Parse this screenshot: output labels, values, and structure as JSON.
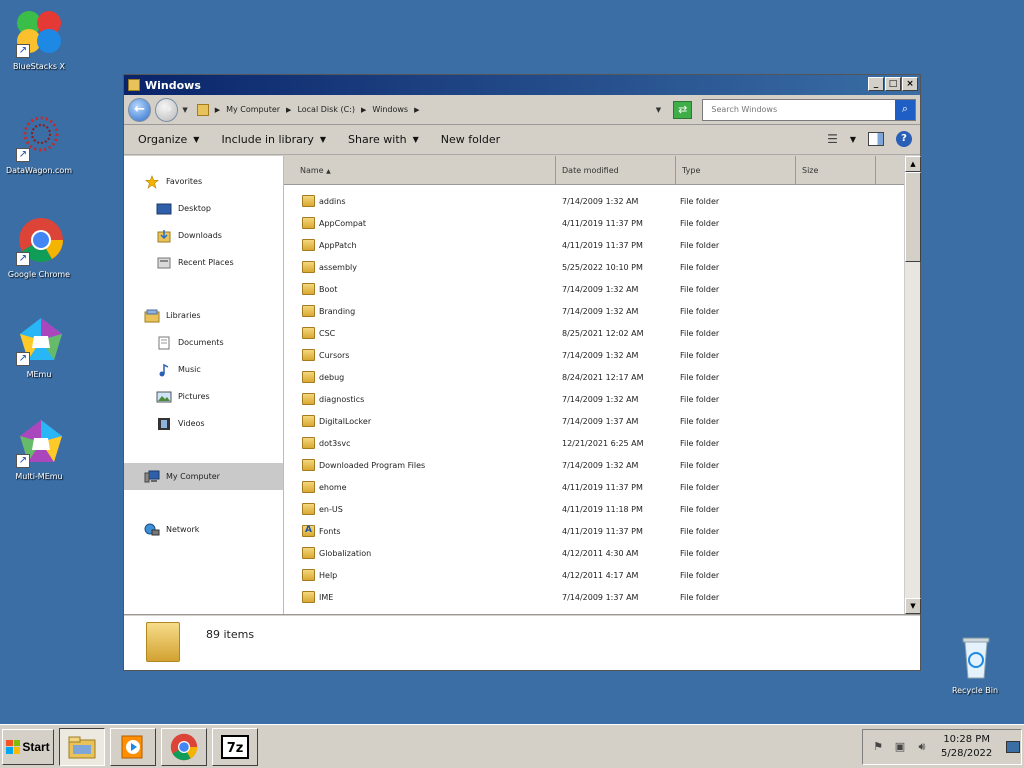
{
  "desktop": {
    "icons": [
      {
        "label": "BlueStacks X"
      },
      {
        "label": "DataWagon.com"
      },
      {
        "label": "Google Chrome"
      },
      {
        "label": "MEmu"
      },
      {
        "label": "Multi-MEmu"
      },
      {
        "label": "Recycle Bin"
      }
    ]
  },
  "window": {
    "title": "Windows",
    "address": {
      "crumbs": [
        "My Computer",
        "Local Disk (C:)",
        "Windows"
      ]
    },
    "search": {
      "placeholder": "Search Windows"
    },
    "toolbar": {
      "organize": "Organize",
      "include": "Include in library",
      "share": "Share with",
      "new_folder": "New folder"
    },
    "nav": {
      "favorites": "Favorites",
      "desktop": "Desktop",
      "downloads": "Downloads",
      "recent": "Recent Places",
      "libraries": "Libraries",
      "documents": "Documents",
      "music": "Music",
      "pictures": "Pictures",
      "videos": "Videos",
      "computer": "My Computer",
      "network": "Network"
    },
    "columns": {
      "name": "Name",
      "date": "Date modified",
      "type": "Type",
      "size": "Size"
    },
    "files": [
      {
        "name": "addins",
        "date": "7/14/2009 1:32 AM",
        "type": "File folder"
      },
      {
        "name": "AppCompat",
        "date": "4/11/2019 11:37 PM",
        "type": "File folder"
      },
      {
        "name": "AppPatch",
        "date": "4/11/2019 11:37 PM",
        "type": "File folder"
      },
      {
        "name": "assembly",
        "date": "5/25/2022 10:10 PM",
        "type": "File folder"
      },
      {
        "name": "Boot",
        "date": "7/14/2009 1:32 AM",
        "type": "File folder"
      },
      {
        "name": "Branding",
        "date": "7/14/2009 1:32 AM",
        "type": "File folder"
      },
      {
        "name": "CSC",
        "date": "8/25/2021 12:02 AM",
        "type": "File folder"
      },
      {
        "name": "Cursors",
        "date": "7/14/2009 1:32 AM",
        "type": "File folder"
      },
      {
        "name": "debug",
        "date": "8/24/2021 12:17 AM",
        "type": "File folder"
      },
      {
        "name": "diagnostics",
        "date": "7/14/2009 1:32 AM",
        "type": "File folder"
      },
      {
        "name": "DigitalLocker",
        "date": "7/14/2009 1:37 AM",
        "type": "File folder"
      },
      {
        "name": "dot3svc",
        "date": "12/21/2021 6:25 AM",
        "type": "File folder"
      },
      {
        "name": "Downloaded Program Files",
        "date": "7/14/2009 1:32 AM",
        "type": "File folder"
      },
      {
        "name": "ehome",
        "date": "4/11/2019 11:37 PM",
        "type": "File folder"
      },
      {
        "name": "en-US",
        "date": "4/11/2019 11:18 PM",
        "type": "File folder"
      },
      {
        "name": "Fonts",
        "date": "4/11/2019 11:37 PM",
        "type": "File folder"
      },
      {
        "name": "Globalization",
        "date": "4/12/2011 4:30 AM",
        "type": "File folder"
      },
      {
        "name": "Help",
        "date": "4/12/2011 4:17 AM",
        "type": "File folder"
      },
      {
        "name": "IME",
        "date": "7/14/2009 1:37 AM",
        "type": "File folder"
      }
    ],
    "status": {
      "count": "89 items"
    }
  },
  "taskbar": {
    "start": "Start",
    "time": "10:28 PM",
    "date": "5/28/2022"
  }
}
